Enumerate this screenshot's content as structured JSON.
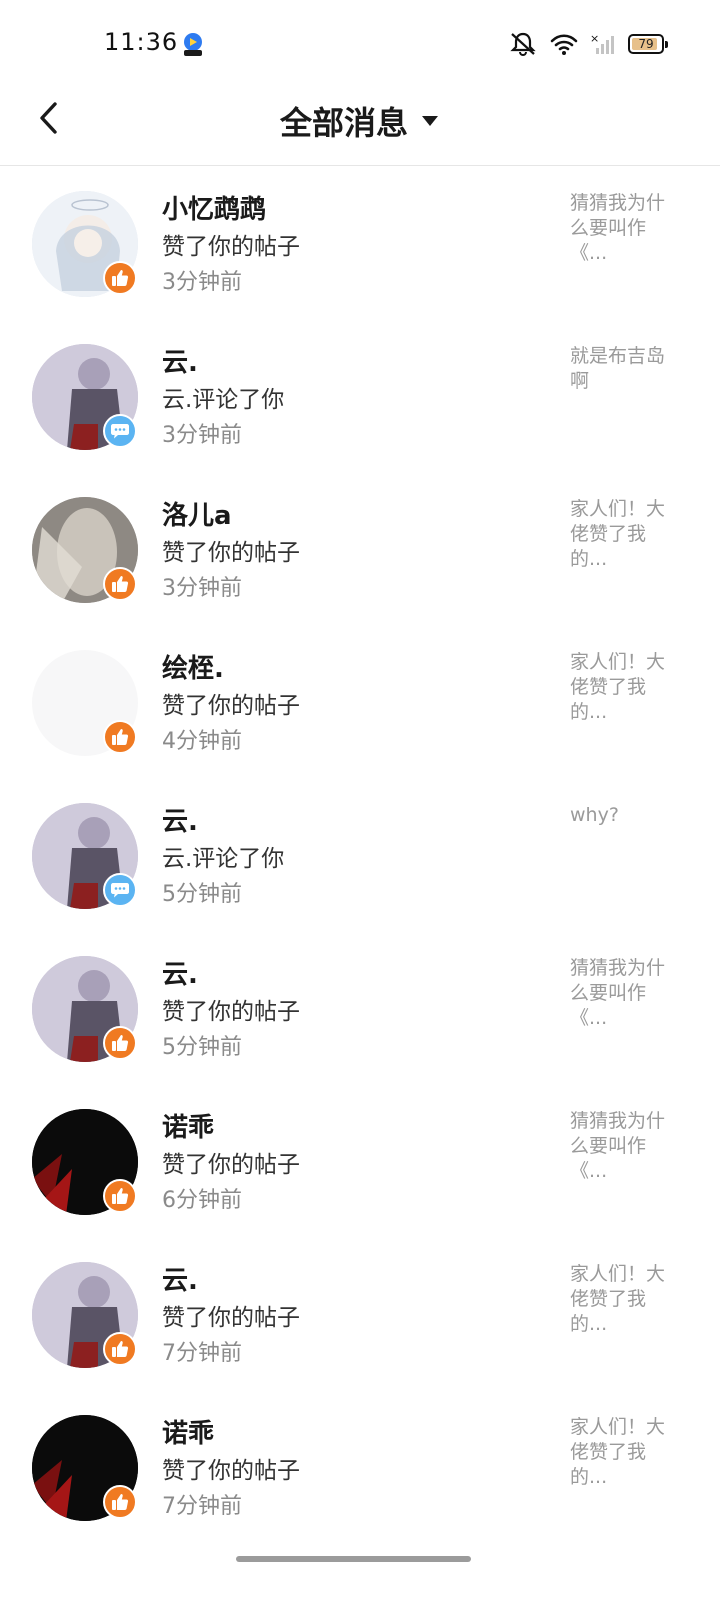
{
  "status_bar": {
    "time": "11:36",
    "battery_level": "79",
    "icons": [
      "bell-off-icon",
      "wifi-icon",
      "no-signal-icon",
      "battery-icon"
    ]
  },
  "header": {
    "back_icon": "chevron-left-icon",
    "title": "全部消息",
    "dropdown_icon": "caret-down-icon"
  },
  "messages": [
    {
      "name": "小忆鹉鹉",
      "action": "赞了你的帖子",
      "time": "3分钟前",
      "preview": "猜猜我为什么要叫作《...",
      "type": "like",
      "avatar_color": "#dfe6ef"
    },
    {
      "name": "云.",
      "action": "云.评论了你",
      "time": "3分钟前",
      "preview": "就是布吉岛啊",
      "type": "comment",
      "avatar_color": "#c9c3d6"
    },
    {
      "name": "洛儿a",
      "action": "赞了你的帖子",
      "time": "3分钟前",
      "preview": "家人们！大佬赞了我的...",
      "type": "like",
      "avatar_color": "#a7a39f"
    },
    {
      "name": "绘桎.",
      "action": "赞了你的帖子",
      "time": "4分钟前",
      "preview": "家人们！大佬赞了我的...",
      "type": "like",
      "avatar_color": "#f7f7f8"
    },
    {
      "name": "云.",
      "action": "云.评论了你",
      "time": "5分钟前",
      "preview": "why?",
      "type": "comment",
      "avatar_color": "#c9c3d6"
    },
    {
      "name": "云.",
      "action": "赞了你的帖子",
      "time": "5分钟前",
      "preview": "猜猜我为什么要叫作《...",
      "type": "like",
      "avatar_color": "#c9c3d6"
    },
    {
      "name": "诺乖",
      "action": "赞了你的帖子",
      "time": "6分钟前",
      "preview": "猜猜我为什么要叫作《...",
      "type": "like",
      "avatar_color": "#0b0b0b"
    },
    {
      "name": "云.",
      "action": "赞了你的帖子",
      "time": "7分钟前",
      "preview": "家人们！大佬赞了我的...",
      "type": "like",
      "avatar_color": "#c9c3d6"
    },
    {
      "name": "诺乖",
      "action": "赞了你的帖子",
      "time": "7分钟前",
      "preview": "家人们！大佬赞了我的...",
      "type": "like",
      "avatar_color": "#0b0b0b"
    }
  ],
  "colors": {
    "like_badge": "#f07a22",
    "comment_badge": "#5bb4f2"
  }
}
